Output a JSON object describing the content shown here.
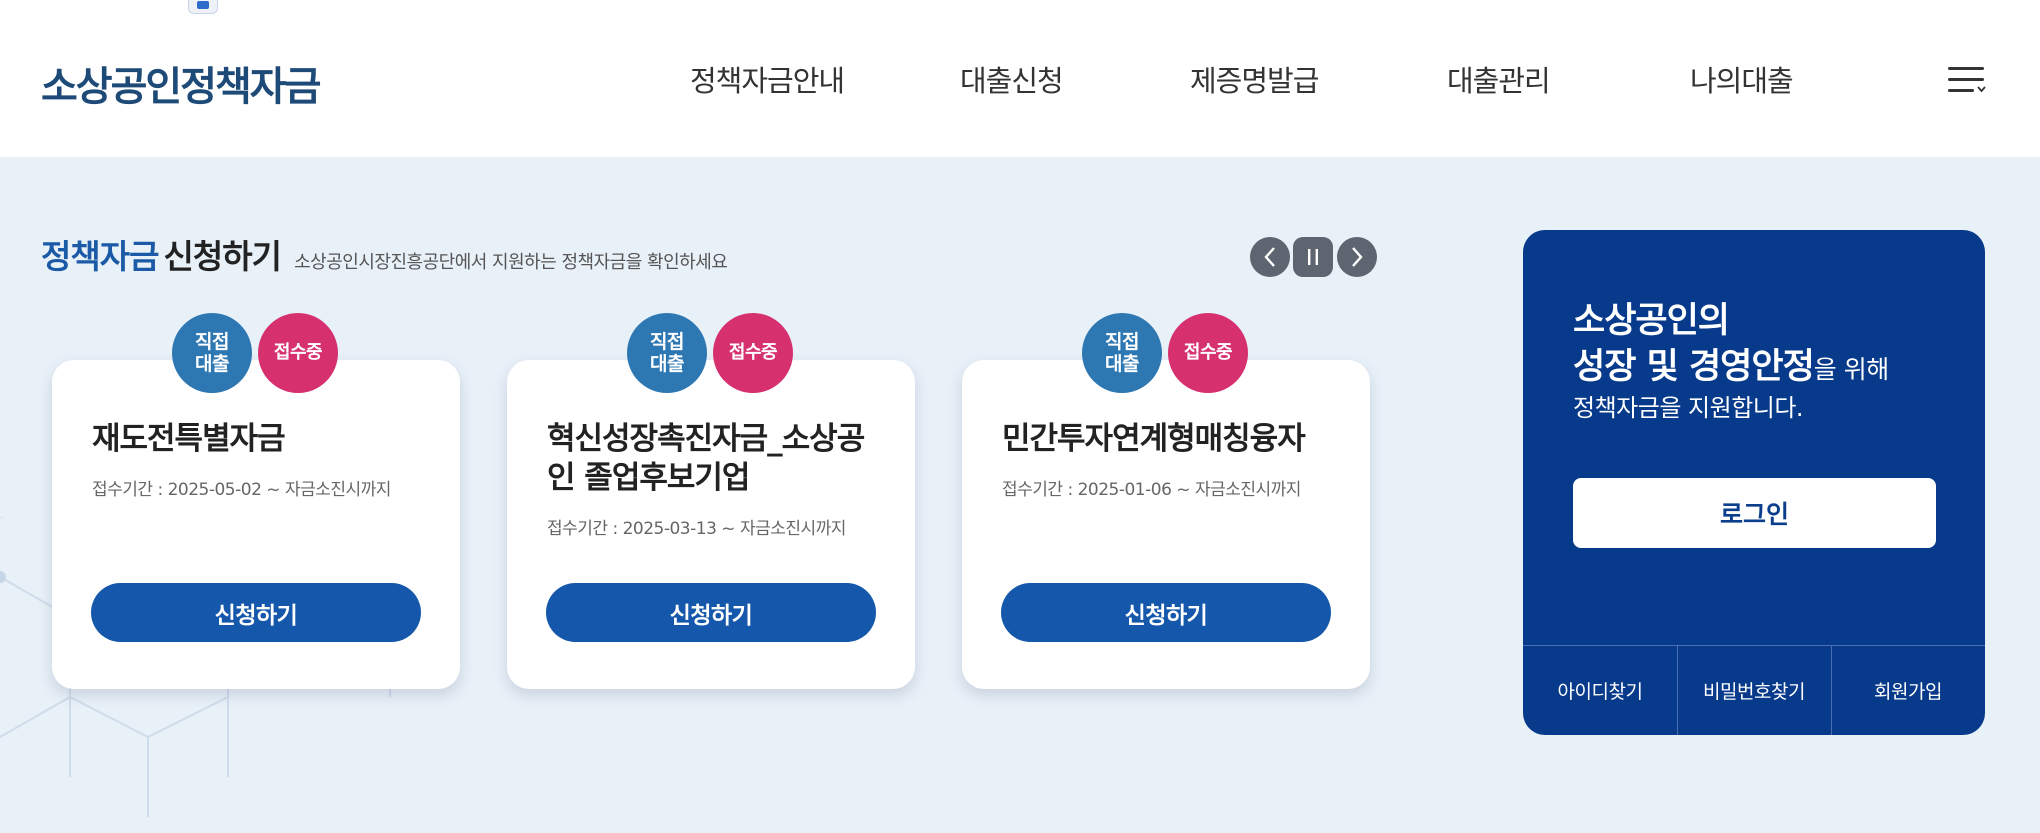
{
  "header": {
    "logo": "소상공인정책자금",
    "nav": [
      {
        "label": "정책자금안내"
      },
      {
        "label": "대출신청"
      },
      {
        "label": "제증명발급"
      },
      {
        "label": "대출관리"
      },
      {
        "label": "나의대출"
      }
    ]
  },
  "section": {
    "title_highlight": "정책자금",
    "title_rest": "신청하기",
    "description": "소상공인시장진흥공단에서 지원하는 정책자금을 확인하세요"
  },
  "cards": [
    {
      "badge_type": "직접\n대출",
      "badge_status": "접수중",
      "title": "재도전특별자금",
      "period": "접수기간 : 2025-05-02 ~ 자금소진시까지",
      "button": "신청하기"
    },
    {
      "badge_type": "직접\n대출",
      "badge_status": "접수중",
      "title": "혁신성장촉진자금_소상공인 졸업후보기업",
      "period": "접수기간 : 2025-03-13 ~ 자금소진시까지",
      "button": "신청하기"
    },
    {
      "badge_type": "직접\n대출",
      "badge_status": "접수중",
      "title": "민간투자연계형매칭융자",
      "period": "접수기간 : 2025-01-06 ~ 자금소진시까지",
      "button": "신청하기"
    }
  ],
  "login_panel": {
    "line1": "소상공인의",
    "line2_bold": "성장 및 경영안정",
    "line2_rest": "을 위해",
    "line3": "정책자금을 지원합니다.",
    "login_button": "로그인",
    "links": [
      "아이디찾기",
      "비밀번호찾기",
      "회원가입"
    ]
  },
  "colors": {
    "brand_navy": "#073a8b",
    "button_blue": "#1558ab",
    "badge_blue": "#2d77b3",
    "badge_pink": "#d6306f",
    "background": "#e8f0f8"
  },
  "icons": [
    "menu-icon",
    "chevron-left-icon",
    "pause-icon",
    "chevron-right-icon"
  ]
}
